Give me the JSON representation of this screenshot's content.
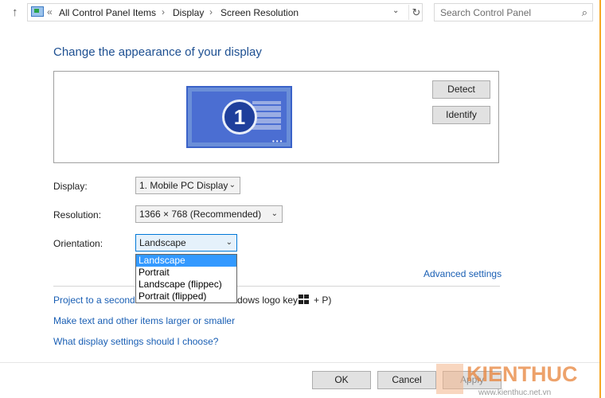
{
  "address_bar": {
    "crumbs": [
      "All Control Panel Items",
      "Display",
      "Screen Resolution"
    ],
    "separator": "›",
    "overflow": "«",
    "search_placeholder": "Search Control Panel"
  },
  "page": {
    "title": "Change the appearance of your display",
    "monitor_number": "1",
    "detect_label": "Detect",
    "identify_label": "Identify"
  },
  "form": {
    "display_label": "Display:",
    "display_value": "1. Mobile PC Display",
    "resolution_label": "Resolution:",
    "resolution_value": "1366 × 768 (Recommended)",
    "orientation_label": "Orientation:",
    "orientation_value": "Landscape",
    "orientation_options": [
      "Landscape",
      "Portrait",
      "Landscape (flippec)",
      "Portrait (flipped)"
    ]
  },
  "links": {
    "advanced_settings": "Advanced settings",
    "project_prefix": "Project to a second",
    "project_suffix": "dows logo key",
    "project_end": "+ P)",
    "text_larger": "Make text and other items larger or smaller",
    "what_settings": "What display settings should I choose?"
  },
  "footer": {
    "ok_label": "OK",
    "cancel_label": "Cancel",
    "apply_label": "Apply"
  },
  "watermark": {
    "brand": "KIENTHUC",
    "url": "www.kienthuc.net.vn"
  },
  "colors": {
    "link": "#1a5fb4",
    "title": "#1d4f91",
    "selection": "#3399ff"
  }
}
